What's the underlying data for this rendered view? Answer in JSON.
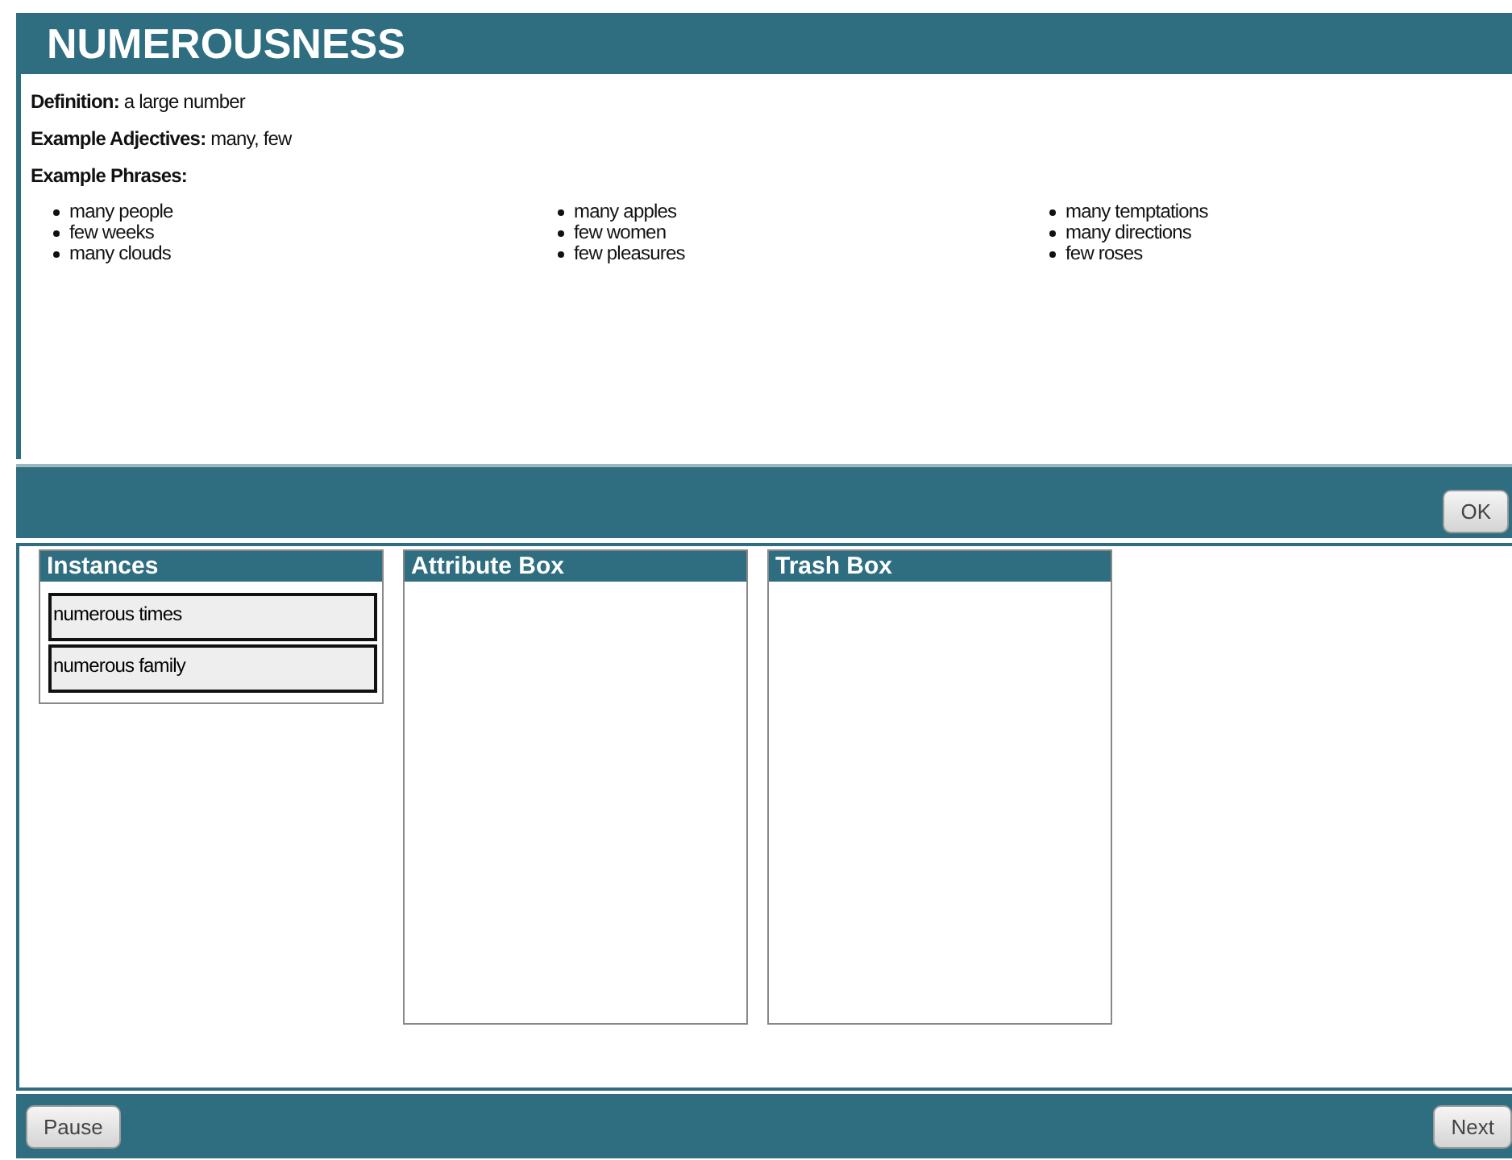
{
  "title": "NUMEROUSNESS",
  "definition": "**Definition:** a large number",
  "adjectives": "**Example Adjectives:** many, few",
  "phrases_label": "Example Phrases:",
  "phrase_columns": [
    [
      "many people",
      "few weeks",
      "many clouds"
    ],
    [
      "many apples",
      "few women",
      "few pleasures"
    ],
    [
      "many temptations",
      "many directions",
      "few roses"
    ]
  ],
  "ok_button": "OK",
  "boxes": [
    {
      "title": "Instances",
      "items": [
        "numerous times",
        "numerous family"
      ]
    },
    {
      "title": "Attribute Box"
    },
    {
      "title": "Trash Box"
    }
  ],
  "pause_button": "Pause",
  "next_button": "Next"
}
